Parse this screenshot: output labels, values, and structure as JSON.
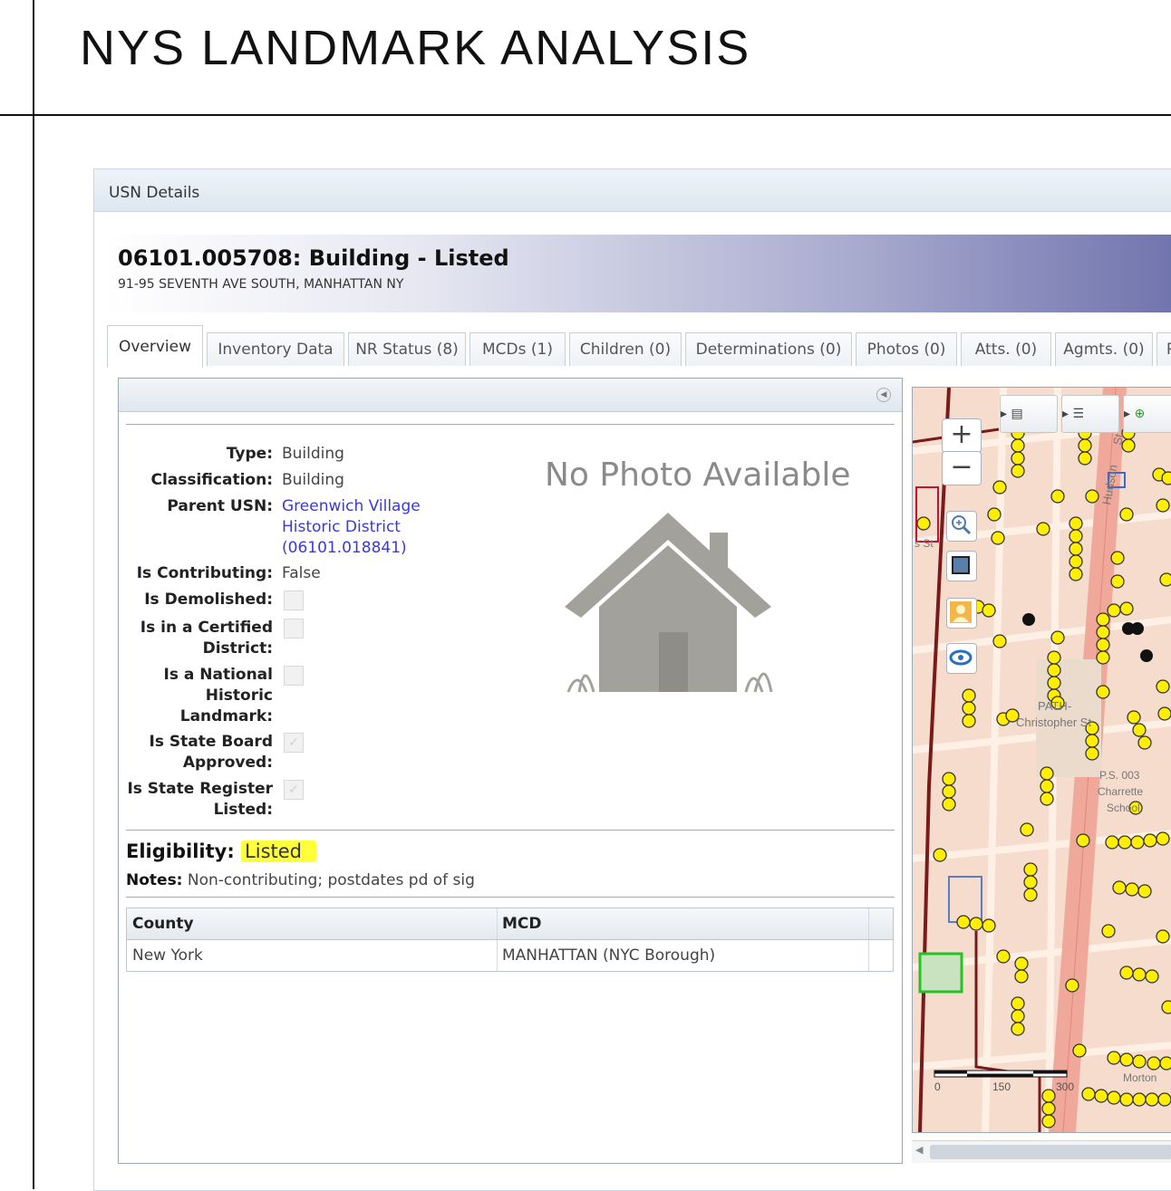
{
  "slide": {
    "title": "NYS LANDMARK ANALYSIS"
  },
  "window": {
    "title": "USN Details"
  },
  "record": {
    "heading": "06101.005708:  Building  - Listed",
    "address": "91-95 SEVENTH AVE SOUTH, MANHATTAN NY"
  },
  "tabs": [
    {
      "label": "Overview",
      "active": true
    },
    {
      "label": "Inventory Data"
    },
    {
      "label": "NR Status (8)"
    },
    {
      "label": "MCDs (1)"
    },
    {
      "label": "Children (0)"
    },
    {
      "label": "Determinations (0)"
    },
    {
      "label": "Photos (0)"
    },
    {
      "label": "Atts. (0)"
    },
    {
      "label": "Agmts. (0)"
    },
    {
      "label": "P"
    }
  ],
  "overview": {
    "type_label": "Type:",
    "type_value": "Building",
    "classification_label": "Classification:",
    "classification_value": "Building",
    "parent_label": "Parent USN:",
    "parent_line1": "Greenwich Village",
    "parent_line2": "Historic District",
    "parent_line3": "(06101.018841)",
    "contributing_label": "Is Contributing:",
    "contributing_value": "False",
    "demolished_label": "Is Demolished:",
    "demolished_checked": false,
    "certified_label_1": "Is in a Certified",
    "certified_label_2": "District:",
    "certified_checked": false,
    "nhl_label_1": "Is a National",
    "nhl_label_2": "Historic",
    "nhl_label_3": "Landmark:",
    "nhl_checked": false,
    "board_label_1": "Is State Board",
    "board_label_2": "Approved:",
    "board_checked": true,
    "register_label_1": "Is State Register",
    "register_label_2": "Listed:",
    "register_checked": true,
    "no_photo_text": "No Photo Available",
    "eligibility_label": "Eligibility:",
    "eligibility_value": "Listed",
    "notes_label": "Notes:",
    "notes_value": "Non-contributing; postdates pd of sig"
  },
  "mcd_table": {
    "columns": [
      "County",
      "MCD"
    ],
    "rows": [
      [
        "New York",
        "MANHATTAN (NYC Borough)"
      ]
    ]
  },
  "map": {
    "zoom_in": "+",
    "zoom_out": "−",
    "labels": {
      "hudson": "Hudson",
      "christopher": "Christopher St",
      "path": "PATH-",
      "st": "St",
      "ps1": "P.S. 003",
      "ps2": "Charrette",
      "ps3": "School",
      "morton": "Morton",
      "s_st": "s St"
    },
    "scale_labels": [
      "0",
      "150",
      "300"
    ],
    "colors": {
      "block": "#f5dccd",
      "street": "#fff0e6",
      "avenue": "#f0a89a",
      "marker": "#ffee00",
      "boundary": "#7a1a1a"
    }
  }
}
